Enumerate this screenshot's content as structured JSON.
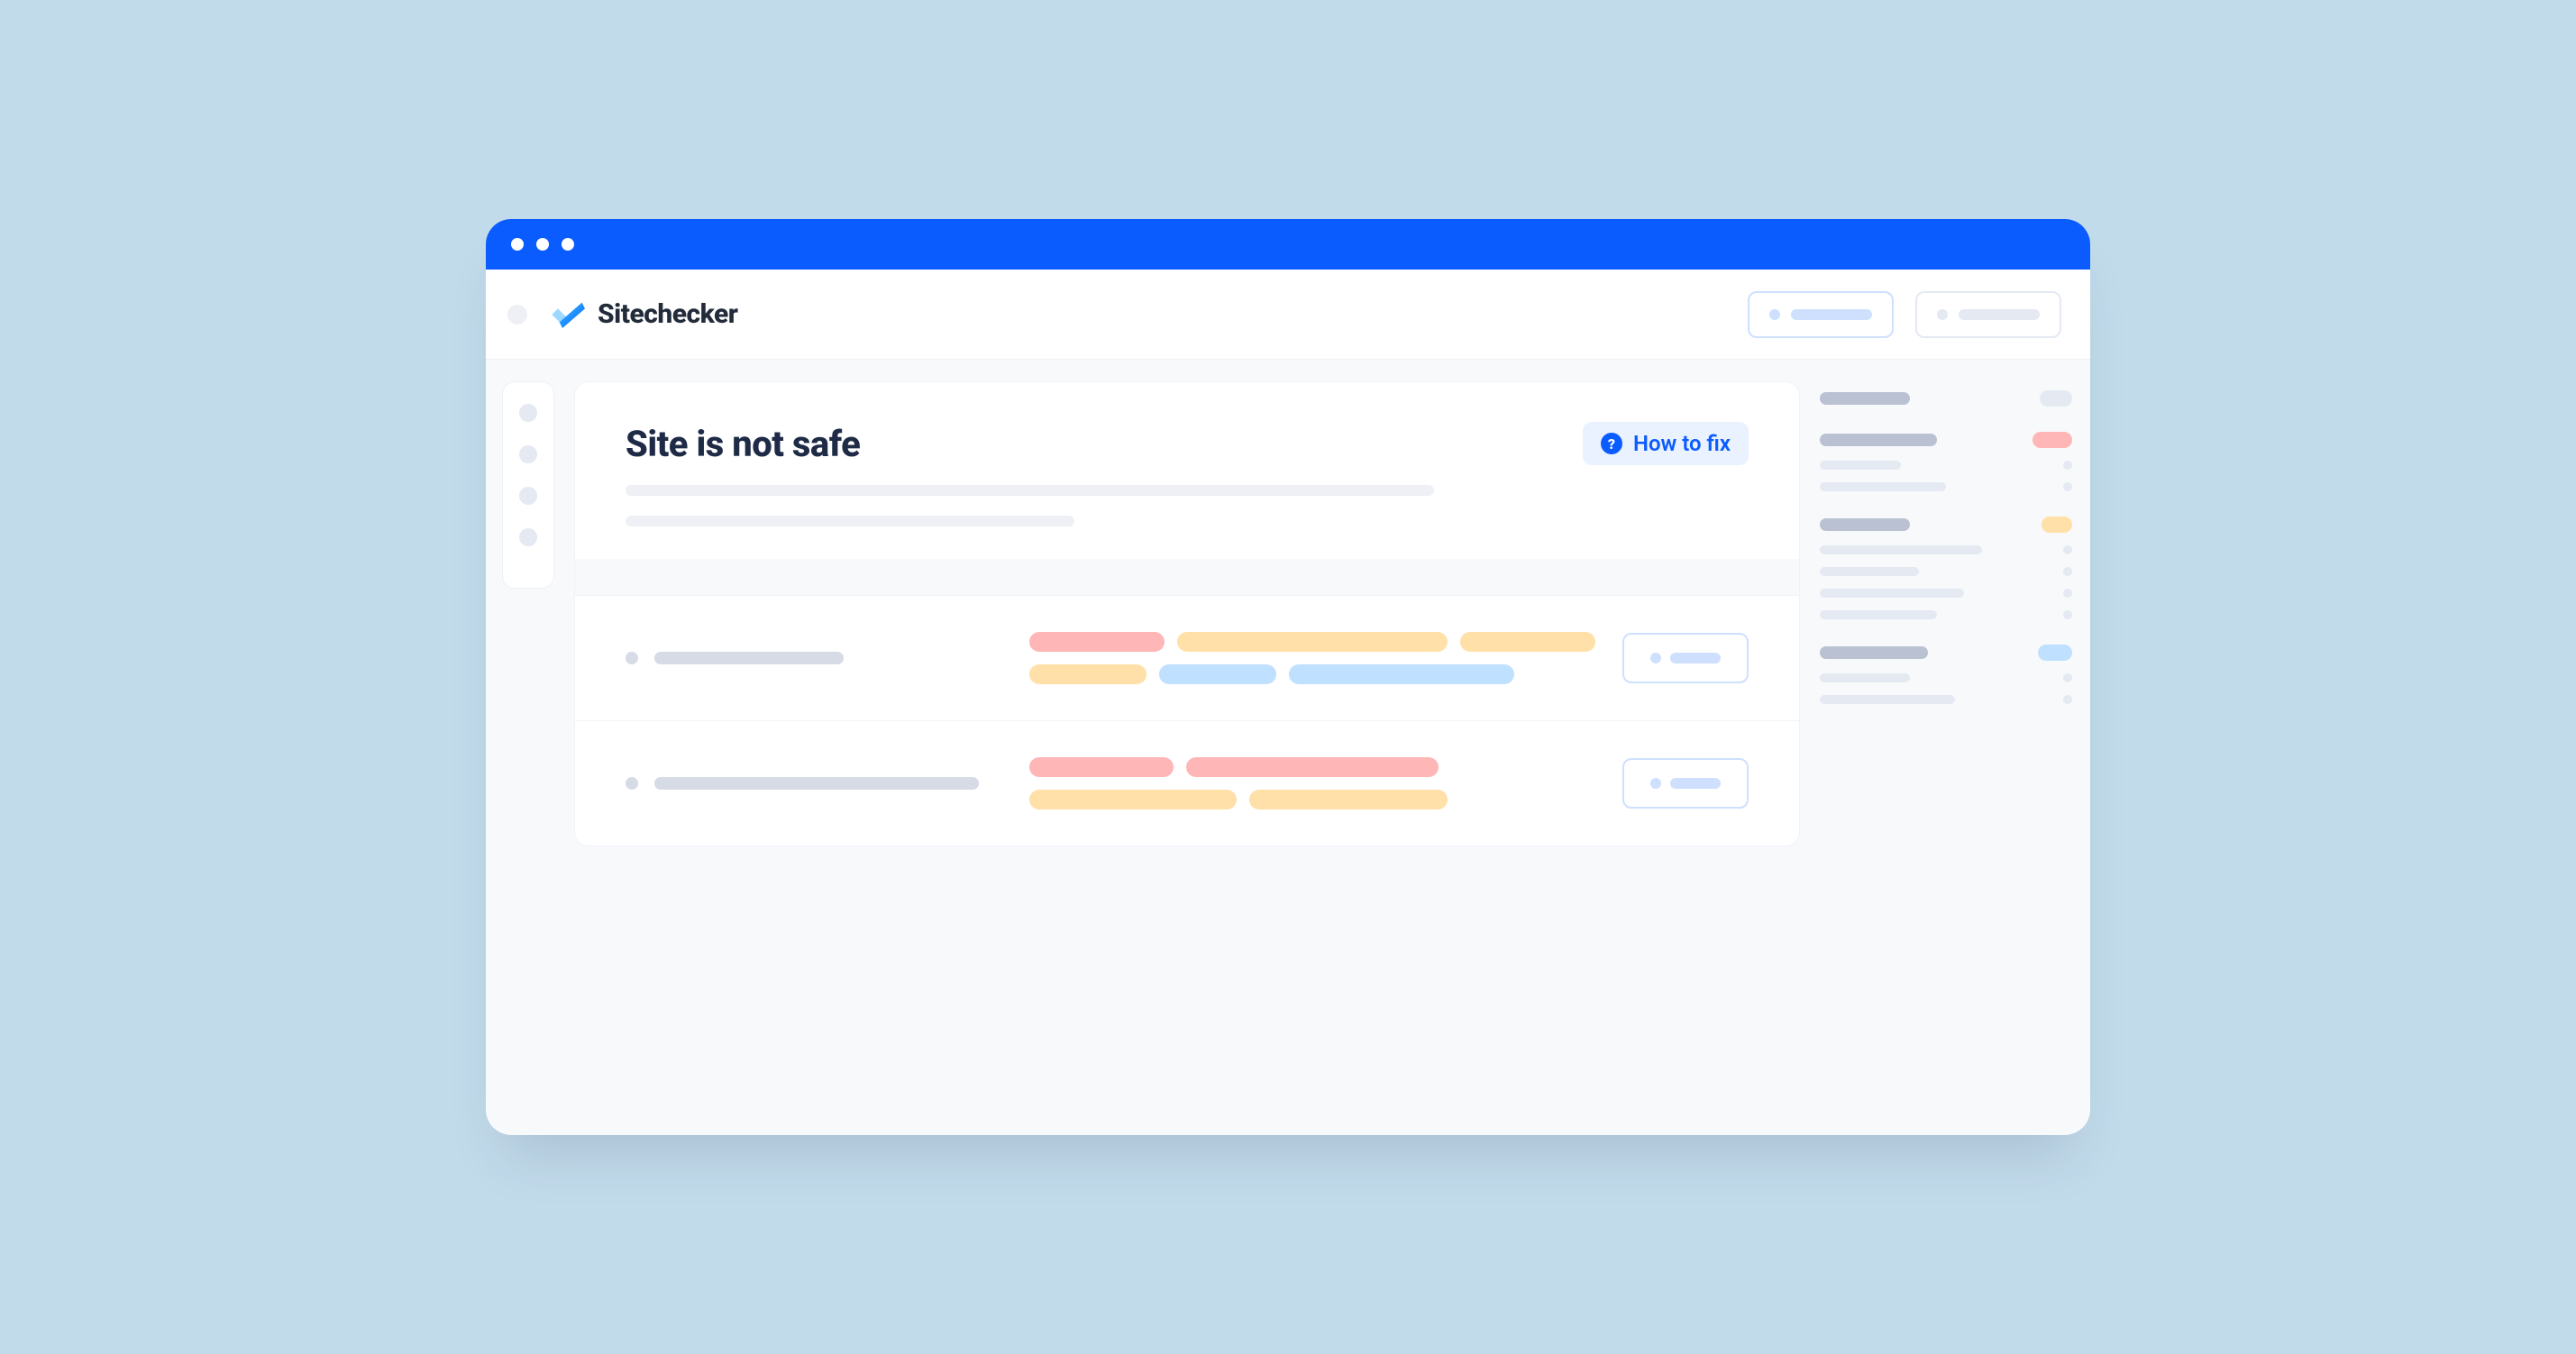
{
  "brand": {
    "name": "Sitechecker"
  },
  "page": {
    "title": "Site is not safe",
    "how_to_fix_label": "How to fix"
  }
}
